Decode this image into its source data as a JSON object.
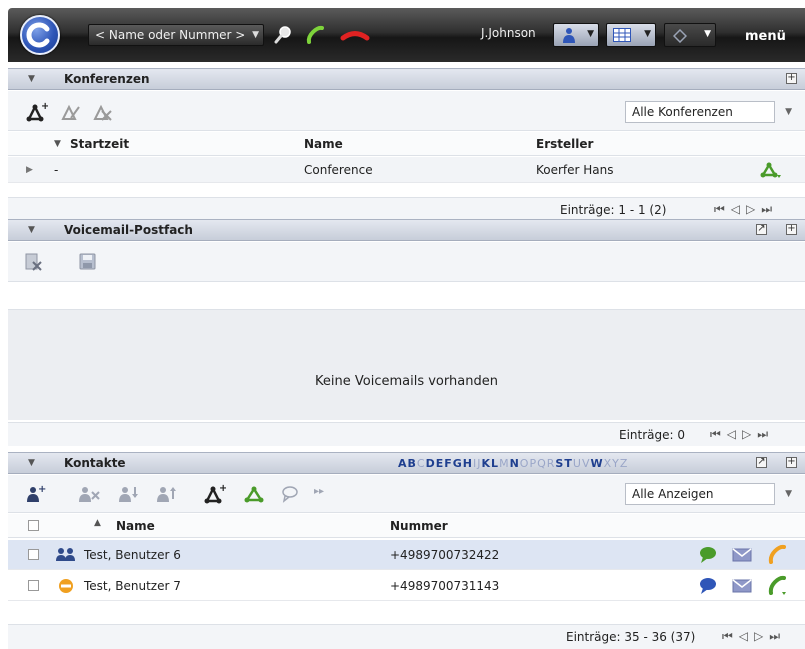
{
  "topbar": {
    "search_placeholder": "< Name oder Nummer >",
    "user_name": "J.Johnson",
    "menu_label": "menü"
  },
  "conferences": {
    "title": "Konferenzen",
    "filter": "Alle Konferenzen",
    "columns": {
      "start": "Startzeit",
      "name": "Name",
      "creator": "Ersteller"
    },
    "row": {
      "start": "-",
      "name": "Conference",
      "creator": "Koerfer Hans"
    },
    "entries": "Einträge: 1 - 1 (2)"
  },
  "voicemail": {
    "title": "Voicemail-Postfach",
    "empty_message": "Keine Voicemails vorhanden",
    "entries": "Einträge: 0"
  },
  "contacts": {
    "title": "Kontakte",
    "letters": [
      {
        "l": "A",
        "on": true
      },
      {
        "l": "B",
        "on": true
      },
      {
        "l": "C",
        "on": false
      },
      {
        "l": "D",
        "on": true
      },
      {
        "l": "E",
        "on": true
      },
      {
        "l": "F",
        "on": true
      },
      {
        "l": "G",
        "on": true
      },
      {
        "l": "H",
        "on": true
      },
      {
        "l": "I",
        "on": false
      },
      {
        "l": "J",
        "on": false
      },
      {
        "l": "K",
        "on": true
      },
      {
        "l": "L",
        "on": true
      },
      {
        "l": "M",
        "on": false
      },
      {
        "l": "N",
        "on": true
      },
      {
        "l": "O",
        "on": false
      },
      {
        "l": "P",
        "on": false
      },
      {
        "l": "Q",
        "on": false
      },
      {
        "l": "R",
        "on": false
      },
      {
        "l": "S",
        "on": true
      },
      {
        "l": "T",
        "on": true
      },
      {
        "l": "U",
        "on": false
      },
      {
        "l": "V",
        "on": false
      },
      {
        "l": "W",
        "on": true
      },
      {
        "l": "X",
        "on": false
      },
      {
        "l": "Y",
        "on": false
      },
      {
        "l": "Z",
        "on": false
      }
    ],
    "filter": "Alle Anzeigen",
    "columns": {
      "name": "Name",
      "number": "Nummer"
    },
    "rows": [
      {
        "name": "Test, Benutzer 6",
        "number": "+4989700732422"
      },
      {
        "name": "Test, Benutzer 7",
        "number": "+4989700731143"
      }
    ],
    "entries": "Einträge: 35 - 36 (37)"
  },
  "colors": {
    "accent": "#2f56b8",
    "header_bg": "#c7cdd9",
    "selected_row": "#dde5f3",
    "green": "#4a9b2a",
    "orange": "#f0a020"
  }
}
